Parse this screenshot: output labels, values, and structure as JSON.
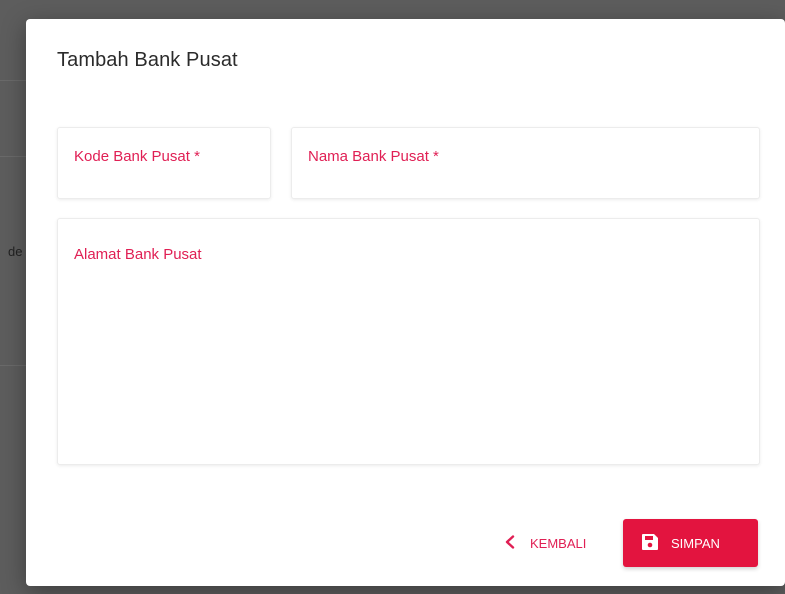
{
  "backdrop": {
    "partial_text": "de"
  },
  "dialog": {
    "title": "Tambah Bank Pusat",
    "fields": {
      "kode_label": "Kode Bank Pusat *",
      "kode_value": "",
      "nama_label": "Nama Bank Pusat *",
      "nama_value": "",
      "alamat_label": "Alamat Bank Pusat",
      "alamat_value": ""
    },
    "actions": {
      "back_label": "KEMBALI",
      "save_label": "SIMPAN"
    }
  },
  "colors": {
    "accent": "#e3143f",
    "label": "#e01f54",
    "backdrop": "#5d5d5d"
  }
}
